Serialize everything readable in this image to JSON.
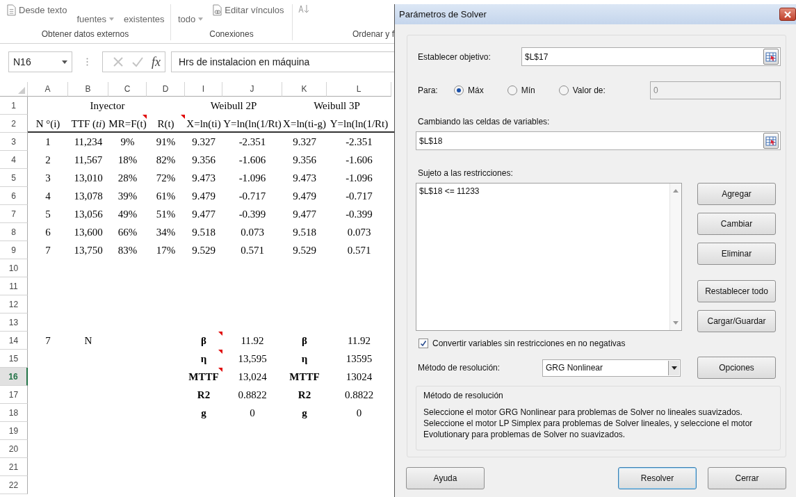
{
  "ribbon": {
    "groups": [
      {
        "label": "Obtener datos externos",
        "buttons": [
          {
            "kind": "file",
            "label": "Desde texto"
          },
          {
            "kind": "dropdown",
            "label": "fuentes"
          },
          {
            "kind": "plain",
            "label": "existentes"
          }
        ]
      },
      {
        "label": "Conexiones",
        "buttons": [
          {
            "kind": "dropdown",
            "label": "todo"
          },
          {
            "kind": "link",
            "label": "Editar vínculos"
          }
        ]
      },
      {
        "label": "Ordenar y f",
        "buttons": [
          {
            "kind": "sort"
          }
        ]
      }
    ]
  },
  "formula_bar": {
    "name_box": "N16",
    "fx": "fx",
    "formula": "Hrs de instalacion en máquina"
  },
  "sheet": {
    "columns": [
      "A",
      "B",
      "C",
      "D",
      "I",
      "J",
      "K",
      "L"
    ],
    "rows": [
      {
        "number": "1",
        "selected": false,
        "cells": [
          "",
          {
            "text": "Inyector",
            "merged": true
          },
          "",
          "",
          {
            "text": "Weibull 2P",
            "merged": true
          },
          "",
          {
            "text": "Weibull 3P",
            "merged": true
          },
          ""
        ]
      },
      {
        "number": "2",
        "selected": false,
        "bottom_border": true,
        "cells": [
          "N °(i)",
          "TTF (*ti*)",
          {
            "text": "MR=F(t)",
            "comment": true
          },
          {
            "text": "R(t)",
            "comment": true
          },
          "X=ln(ti)",
          "Y=ln(ln(1/Rt)",
          "X=ln(ti-g)",
          "Y=ln(ln(1/Rt)"
        ]
      },
      {
        "number": "3",
        "selected": false,
        "cells": [
          "1",
          "11,234",
          "9%",
          "91%",
          "9.327",
          "-2.351",
          "9.327",
          "-2.351"
        ]
      },
      {
        "number": "4",
        "selected": false,
        "cells": [
          "2",
          "11,567",
          "18%",
          "82%",
          "9.356",
          "-1.606",
          "9.356",
          "-1.606"
        ]
      },
      {
        "number": "5",
        "selected": false,
        "cells": [
          "3",
          "13,010",
          "28%",
          "72%",
          "9.473",
          "-1.096",
          "9.473",
          "-1.096"
        ]
      },
      {
        "number": "6",
        "selected": false,
        "cells": [
          "4",
          "13,078",
          "39%",
          "61%",
          "9.479",
          "-0.717",
          "9.479",
          "-0.717"
        ]
      },
      {
        "number": "7",
        "selected": false,
        "cells": [
          "5",
          "13,056",
          "49%",
          "51%",
          "9.477",
          "-0.399",
          "9.477",
          "-0.399"
        ]
      },
      {
        "number": "8",
        "selected": false,
        "cells": [
          "6",
          "13,600",
          "66%",
          "34%",
          "9.518",
          "0.073",
          "9.518",
          "0.073"
        ]
      },
      {
        "number": "9",
        "selected": false,
        "cells": [
          "7",
          "13,750",
          "83%",
          "17%",
          "9.529",
          "0.571",
          "9.529",
          "0.571"
        ]
      },
      {
        "number": "10",
        "selected": false
      },
      {
        "number": "11",
        "selected": false
      },
      {
        "number": "12",
        "selected": false
      },
      {
        "number": "13",
        "selected": false
      },
      {
        "number": "14",
        "selected": false,
        "cells": [
          "7",
          "N",
          "",
          "",
          {
            "text": "β",
            "bold": true,
            "comment": true
          },
          "11.92",
          {
            "text": "β",
            "bold": true
          },
          "11.92"
        ]
      },
      {
        "number": "15",
        "selected": false,
        "cells": [
          "",
          "",
          "",
          "",
          {
            "text": "η",
            "bold": true,
            "comment": true
          },
          "13,595",
          {
            "text": "η",
            "bold": true
          },
          "13595"
        ]
      },
      {
        "number": "16",
        "selected": true,
        "cells": [
          "",
          "",
          "",
          "",
          {
            "text": "MTTF",
            "bold": true,
            "comment": true
          },
          "13,024",
          {
            "text": "MTTF",
            "bold": true
          },
          "13024"
        ]
      },
      {
        "number": "17",
        "selected": false,
        "cells": [
          "",
          "",
          "",
          "",
          {
            "text": "R2",
            "bold": true
          },
          "0.8822",
          {
            "text": "R2",
            "bold": true
          },
          "0.8822"
        ]
      },
      {
        "number": "18",
        "selected": false,
        "cells": [
          "",
          "",
          "",
          "",
          {
            "text": "g",
            "bold": true
          },
          "0",
          {
            "text": "g",
            "bold": true
          },
          "0"
        ]
      },
      {
        "number": "19",
        "selected": false
      },
      {
        "number": "20",
        "selected": false
      },
      {
        "number": "21",
        "selected": false
      },
      {
        "number": "22",
        "selected": false
      }
    ]
  },
  "dialog": {
    "title": "Parámetros de Solver",
    "objective": {
      "label": "Establecer objetivo:",
      "value": "$L$17"
    },
    "to": {
      "label": "Para:",
      "options": [
        {
          "label": "Máx",
          "selected": true
        },
        {
          "label": "Mín",
          "selected": false
        },
        {
          "label": "Valor de:",
          "selected": false
        }
      ],
      "value": "0",
      "disabled": true
    },
    "variables": {
      "label": "Cambiando las celdas de variables:",
      "value": "$L$18"
    },
    "constraints": {
      "label": "Sujeto a las restricciones:",
      "items": [
        "$L$18 <= 11233"
      ]
    },
    "constraint_buttons": [
      "Agregar",
      "Cambiar",
      "Eliminar",
      "Restablecer todo",
      "Cargar/Guardar"
    ],
    "nonnegative": {
      "label": "Convertir variables sin restricciones en no negativas",
      "checked": true
    },
    "method": {
      "label": "Método de resolución:",
      "value": "GRG Nonlinear"
    },
    "options_button": "Opciones",
    "description": {
      "title": "Método de resolución",
      "text": "Seleccione el motor GRG Nonlinear para problemas de Solver no lineales suavizados. Seleccione el motor LP Simplex para problemas de Solver lineales, y seleccione el motor Evolutionary para problemas de Solver no suavizados."
    },
    "footer_buttons": [
      {
        "label": "Ayuda",
        "default": false
      },
      {
        "label": "Resolver",
        "default": true
      },
      {
        "label": "Cerrar",
        "default": false
      }
    ]
  }
}
